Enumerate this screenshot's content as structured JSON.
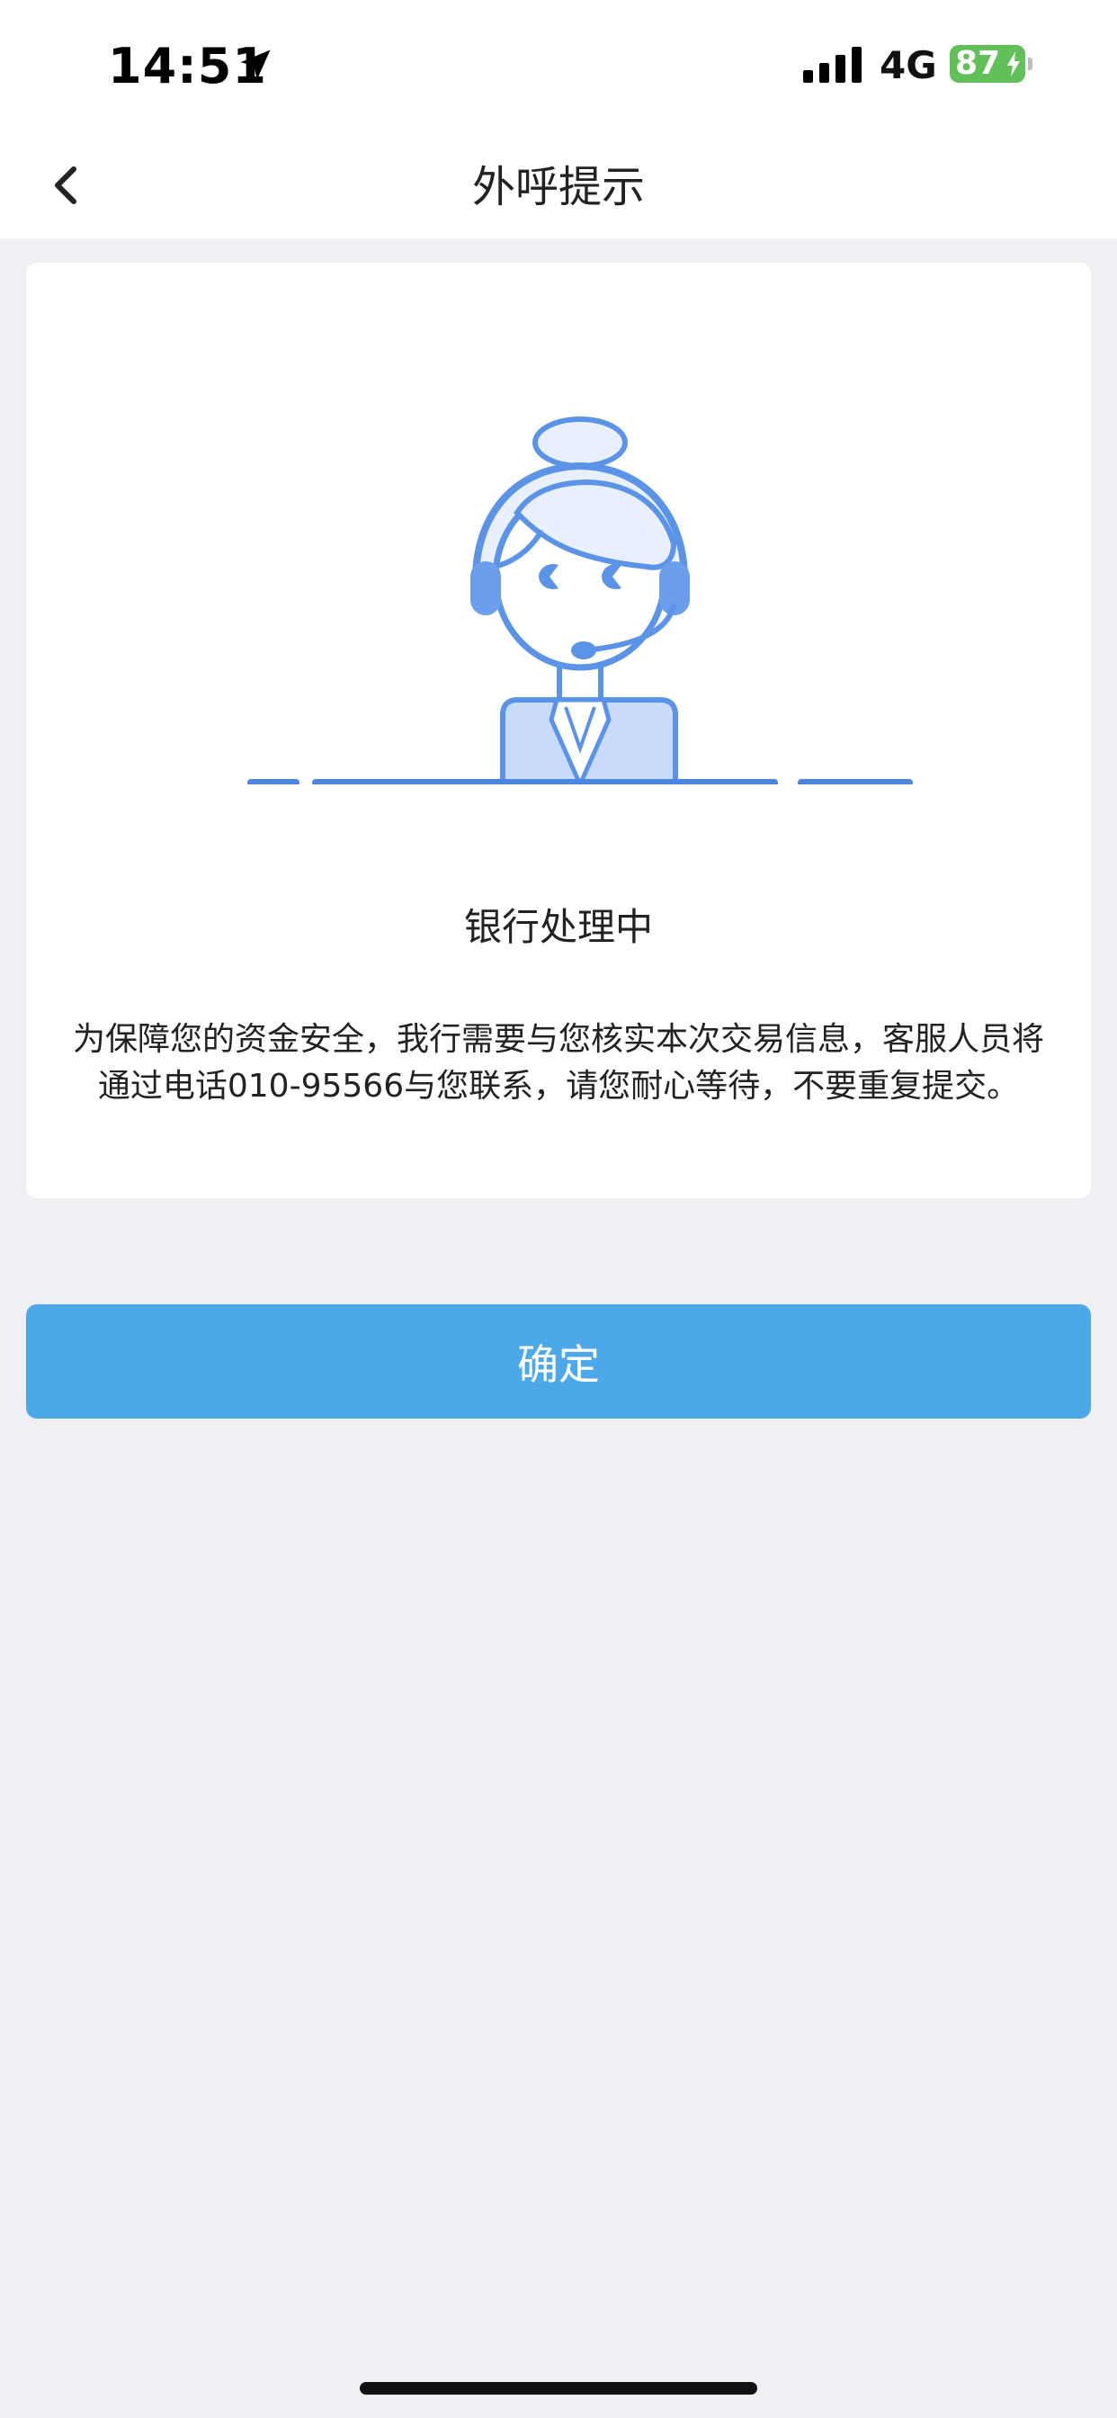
{
  "status_bar": {
    "time": "14:51",
    "network": "4G",
    "battery": "87"
  },
  "nav": {
    "title": "外呼提示"
  },
  "card": {
    "title": "银行处理中",
    "description": "为保障您的资金安全，我行需要与您核实本次交易信息，客服人员将通过电话010-95566与您联系，请您耐心等待，不要重复提交。"
  },
  "actions": {
    "confirm_label": "确定"
  },
  "colors": {
    "primary": "#4DA8E9",
    "illustration_blue": "#5B93E8",
    "illustration_fill": "#E8F0FD",
    "battery_green": "#62C05B",
    "page_bg": "#EFEFF4"
  },
  "icons": [
    "location-arrow-icon",
    "signal-icon",
    "battery-icon",
    "charging-bolt-icon",
    "back-chevron-icon",
    "customer-service-agent-illustration"
  ]
}
